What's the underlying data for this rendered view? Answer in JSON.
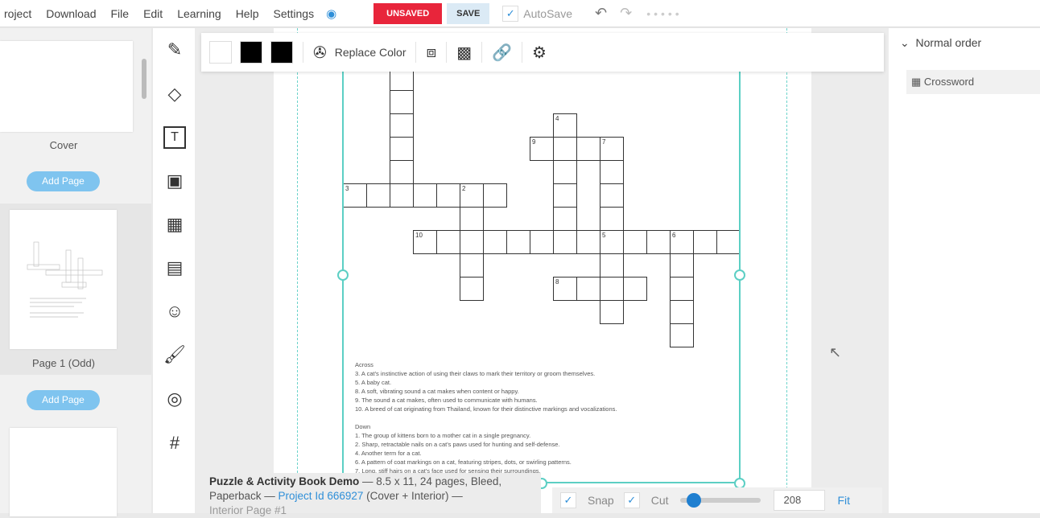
{
  "menu": [
    "roject",
    "Download",
    "File",
    "Edit",
    "Learning",
    "Help",
    "Settings"
  ],
  "status": {
    "unsaved": "UNSAVED",
    "save": "SAVE",
    "autosave": "AutoSave"
  },
  "left": {
    "pages": [
      "Cover",
      "Page 1 (Odd)"
    ],
    "add_page": "Add Page"
  },
  "toolbar": {
    "replace_color": "Replace Color",
    "swatches": [
      "#ffffff",
      "#000000",
      "#000000"
    ]
  },
  "crossword": {
    "numbers": {
      "3": "3",
      "2": "2",
      "4": "4",
      "9": "9",
      "7": "7",
      "10": "10",
      "5": "5",
      "6": "6",
      "8": "8"
    },
    "across_title": "Across",
    "across": [
      "3. A cat's instinctive action of using their claws to mark their territory or groom themselves.",
      "5.  A baby cat.",
      "8. A soft, vibrating sound a cat makes when content or happy.",
      "9. The sound a cat makes, often used to communicate with humans.",
      "10. A breed of cat originating from Thailand, known for their distinctive markings and vocalizations."
    ],
    "down_title": "Down",
    "down": [
      "1. The group of kittens born to a mother cat in a single pregnancy.",
      "2. Sharp, retractable nails on a cat's paws used for hunting and self-defense.",
      "4. Another term for a cat.",
      "6. A pattern of coat markings on a cat, featuring stripes, dots, or swirling patterns.",
      "7. Long, stiff hairs on a cat's face used for sensing their surroundings."
    ]
  },
  "info": {
    "title": "Puzzle & Activity Book Demo",
    "details": " — 8.5 x 11, 24 pages, Bleed, Paperback — ",
    "project_link": "Project Id 666927",
    "after": " (Cover + Interior) —",
    "page": "Interior Page #1"
  },
  "bottom": {
    "snap": "Snap",
    "cut": "Cut",
    "zoom": "208",
    "fit": "Fit",
    "zoom_slider_fraction": 0.1
  },
  "right": {
    "order": "Normal order",
    "layer": "Crossword"
  },
  "colors": {
    "accent": "#2f8fd8",
    "unsaved": "#e8253b",
    "selection": "#5ccfc4"
  }
}
